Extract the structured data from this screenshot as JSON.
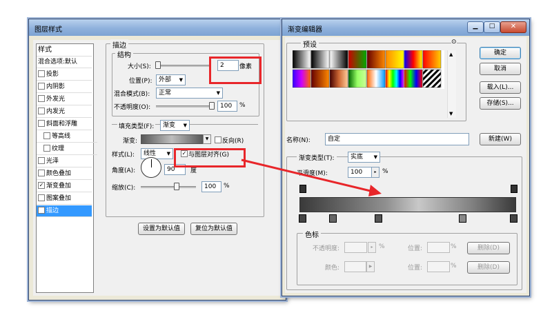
{
  "layer_style": {
    "title": "图层样式",
    "styles_header": "样式",
    "blend_default": "混合选项:默认",
    "items": [
      {
        "label": "投影",
        "checked": false,
        "indent": false,
        "active": false
      },
      {
        "label": "内阴影",
        "checked": false,
        "indent": false,
        "active": false
      },
      {
        "label": "外发光",
        "checked": false,
        "indent": false,
        "active": false
      },
      {
        "label": "内发光",
        "checked": false,
        "indent": false,
        "active": false
      },
      {
        "label": "斜面和浮雕",
        "checked": false,
        "indent": false,
        "active": false
      },
      {
        "label": "等高线",
        "checked": false,
        "indent": true,
        "active": false
      },
      {
        "label": "纹理",
        "checked": false,
        "indent": true,
        "active": false
      },
      {
        "label": "光泽",
        "checked": false,
        "indent": false,
        "active": false
      },
      {
        "label": "颜色叠加",
        "checked": false,
        "indent": false,
        "active": false
      },
      {
        "label": "渐变叠加",
        "checked": true,
        "indent": false,
        "active": false
      },
      {
        "label": "图案叠加",
        "checked": false,
        "indent": false,
        "active": false
      },
      {
        "label": "描边",
        "checked": true,
        "indent": false,
        "active": true
      }
    ],
    "stroke": {
      "section": "描边",
      "structure": "结构",
      "size_label": "大小(S):",
      "size_value": "2",
      "size_unit": "像素",
      "position_label": "位置(P):",
      "position_value": "外部",
      "blend_label": "混合模式(B):",
      "blend_value": "正常",
      "opacity_label": "不透明度(O):",
      "opacity_value": "100",
      "percent": "%",
      "fill_type_label": "填充类型(F):",
      "fill_type_value": "渐变",
      "gradient_label": "渐变:",
      "reverse_label": "反向(R)",
      "style_label": "样式(L):",
      "style_value": "线性",
      "align_label": "与图层对齐(G)",
      "angle_label": "角度(A):",
      "angle_value": "90",
      "angle_unit": "度",
      "scale_label": "缩放(C):",
      "scale_value": "100",
      "default_btn": "设置为默认值",
      "reset_btn": "复位为默认值"
    }
  },
  "gradient_editor": {
    "title": "渐变编辑器",
    "presets_label": "预设",
    "ok": "确定",
    "cancel": "取消",
    "load": "载入(L)...",
    "save": "存储(S)...",
    "name_label": "名称(N):",
    "name_value": "自定",
    "new_btn": "新建(W)",
    "type_label": "渐变类型(T):",
    "type_value": "实底",
    "smooth_label": "平滑度(M):",
    "smooth_value": "100",
    "percent": "%",
    "stops_section": "色标",
    "opacity_label": "不透明度:",
    "opacity_unit": "%",
    "location_label": "位置:",
    "location_unit": "%",
    "color_label": "颜色:",
    "delete_btn": "删除(D)"
  },
  "colors": {
    "highlight": "#e8262a",
    "selection": "#3399ff"
  }
}
